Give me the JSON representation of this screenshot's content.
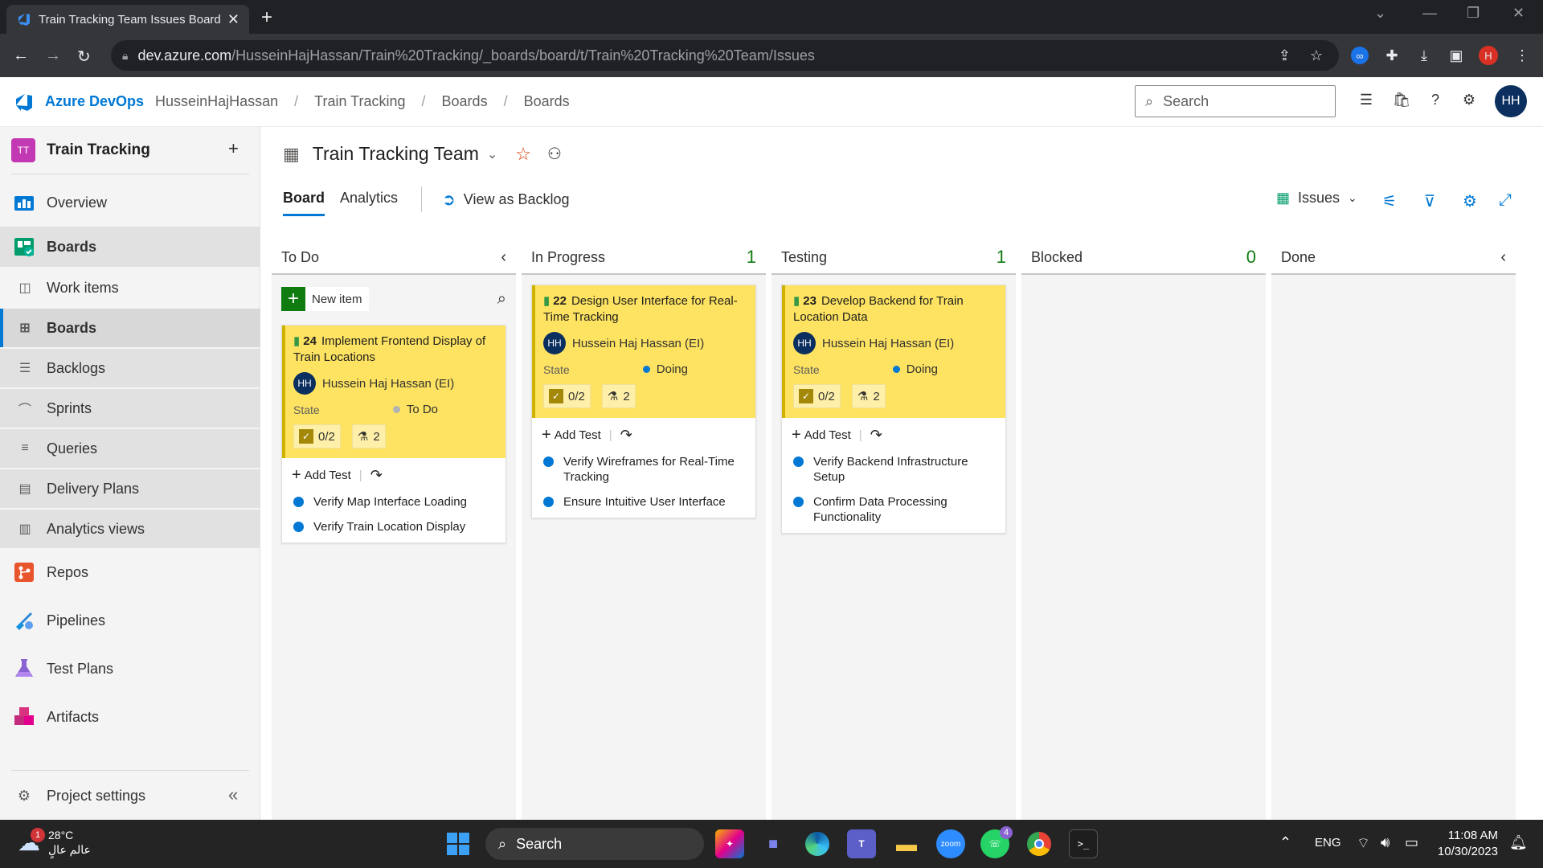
{
  "browser": {
    "tab_title": "Train Tracking Team Issues Board",
    "url_host": "dev.azure.com",
    "url_path": "/HusseinHajHassan/Train%20Tracking/_boards/board/t/Train%20Tracking%20Team/Issues"
  },
  "header": {
    "brand": "Azure DevOps",
    "breadcrumbs": [
      "HusseinHajHassan",
      "Train Tracking",
      "Boards",
      "Boards"
    ],
    "search_placeholder": "Search",
    "avatar_initials": "HH"
  },
  "sidebar": {
    "project_badge": "TT",
    "project_name": "Train Tracking",
    "items": [
      {
        "label": "Overview",
        "icon": "overview-icon"
      },
      {
        "label": "Boards",
        "icon": "boards-icon"
      },
      {
        "label": "Work items",
        "icon": "work-items-icon"
      },
      {
        "label": "Boards",
        "icon": "boards-sub-icon"
      },
      {
        "label": "Backlogs",
        "icon": "backlogs-icon"
      },
      {
        "label": "Sprints",
        "icon": "sprints-icon"
      },
      {
        "label": "Queries",
        "icon": "queries-icon"
      },
      {
        "label": "Delivery Plans",
        "icon": "delivery-plans-icon"
      },
      {
        "label": "Analytics views",
        "icon": "analytics-views-icon"
      },
      {
        "label": "Repos",
        "icon": "repos-icon"
      },
      {
        "label": "Pipelines",
        "icon": "pipelines-icon"
      },
      {
        "label": "Test Plans",
        "icon": "test-plans-icon"
      },
      {
        "label": "Artifacts",
        "icon": "artifacts-icon"
      }
    ],
    "project_settings": "Project settings"
  },
  "main": {
    "team_name": "Train Tracking Team",
    "tabs": {
      "board": "Board",
      "analytics": "Analytics",
      "view_as_backlog": "View as Backlog"
    },
    "backlog_level": "Issues",
    "new_item": "New item",
    "columns": [
      {
        "name": "To Do",
        "count": ""
      },
      {
        "name": "In Progress",
        "count": "1"
      },
      {
        "name": "Testing",
        "count": "1"
      },
      {
        "name": "Blocked",
        "count": "0"
      },
      {
        "name": "Done",
        "count": ""
      }
    ],
    "cards": [
      {
        "id": "24",
        "title": "Implement Frontend Display of Train Locations",
        "assignee_initials": "HH",
        "assignee": "Hussein Haj Hassan (EI)",
        "state_label": "State",
        "state": "To Do",
        "tasks": "0/2",
        "tests": "2",
        "add_test": "Add Test",
        "test_items": [
          "Verify Map Interface Loading",
          "Verify Train Location Display"
        ]
      },
      {
        "id": "22",
        "title": "Design User Interface for Real-Time Tracking",
        "assignee_initials": "HH",
        "assignee": "Hussein Haj Hassan (EI)",
        "state_label": "State",
        "state": "Doing",
        "tasks": "0/2",
        "tests": "2",
        "add_test": "Add Test",
        "test_items": [
          "Verify Wireframes for Real-Time Tracking",
          "Ensure Intuitive User Interface"
        ]
      },
      {
        "id": "23",
        "title": "Develop Backend for Train Location Data",
        "assignee_initials": "HH",
        "assignee": "Hussein Haj Hassan (EI)",
        "state_label": "State",
        "state": "Doing",
        "tasks": "0/2",
        "tests": "2",
        "add_test": "Add Test",
        "test_items": [
          "Verify Backend Infrastructure Setup",
          "Confirm Data Processing Functionality"
        ]
      }
    ]
  },
  "taskbar": {
    "weather_temp": "28°C",
    "weather_text": "عالم عالٍ",
    "weather_badge": "1",
    "search": "Search",
    "language": "ENG",
    "time": "11:08 AM",
    "date": "10/30/2023",
    "whatsapp_badge": "4"
  },
  "colors": {
    "accent": "#0078d4",
    "card_yellow": "#fde361",
    "card_border": "#cfb100",
    "doing_dot": "#0078d4",
    "todo_dot": "#b2b2b2",
    "count_green": "#107c10"
  }
}
